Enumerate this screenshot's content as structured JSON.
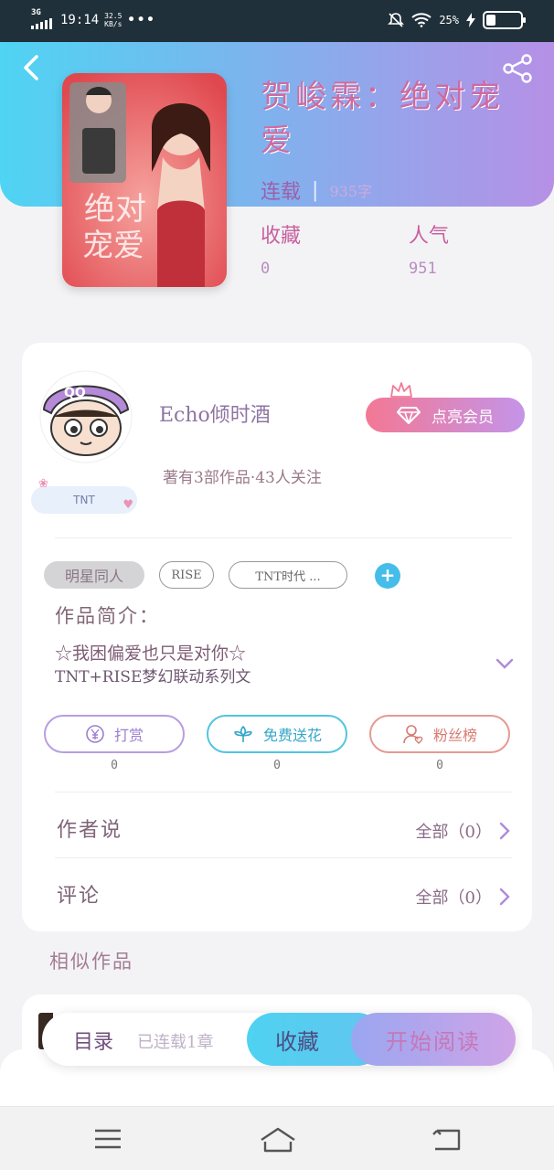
{
  "status_bar": {
    "network": "3G",
    "time": "19:14",
    "speed_value": "32.5",
    "speed_unit": "KB/s",
    "more": "•••",
    "battery_percent": "25%"
  },
  "book": {
    "title": "贺峻霖：绝对宠爱",
    "status": "连载",
    "word_count": "935字",
    "stats": [
      {
        "label": "收藏",
        "value": "0"
      },
      {
        "label": "人气",
        "value": "951"
      }
    ]
  },
  "author": {
    "name": "Echo倾时酒",
    "meta": "著有3部作品·43人关注",
    "badge": "TNT",
    "vip_label": "点亮会员"
  },
  "tags": [
    "明星同人",
    "RISE",
    "TNT时代 ..."
  ],
  "intro": {
    "title": "作品简介：",
    "line1": "☆我困偏爱也只是对你☆",
    "line2": "TNT+RISE梦幻联动系列文"
  },
  "actions": [
    {
      "label": "打赏",
      "count": "0",
      "icon": "yen-coin-icon"
    },
    {
      "label": "免费送花",
      "count": "0",
      "icon": "flower-icon"
    },
    {
      "label": "粉丝榜",
      "count": "0",
      "icon": "fan-user-icon"
    }
  ],
  "rows": [
    {
      "label": "作者说",
      "right": "全部（0）"
    },
    {
      "label": "评论",
      "right": "全部（0）"
    }
  ],
  "similar_title": "相似作品",
  "bottom_bar": {
    "toc": "目录",
    "chapters": "已连载1章",
    "collect": "收藏",
    "read": "开始阅读"
  },
  "colors": {
    "header_gradient_start": "#4fd4f3",
    "header_gradient_end": "#b690e6",
    "vip_gradient_start": "#f37894",
    "vip_gradient_end": "#c494e8",
    "accent_blue": "#45bde9"
  }
}
